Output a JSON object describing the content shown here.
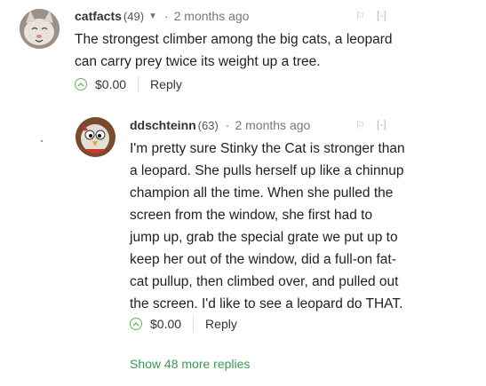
{
  "comments": [
    {
      "username": "catfacts",
      "score": "(49)",
      "time": "2 months ago",
      "text_lines": [
        "The strongest climber among the big cats, a leopard",
        "can carry prey twice its weight up a tree."
      ],
      "tip": "$0.00",
      "reply_label": "Reply",
      "avatar_icon": "cat-face-avatar"
    },
    {
      "username": "ddschteinn",
      "score": "(63)",
      "time": "2 months ago",
      "text_lines": [
        "I'm pretty sure Stinky the Cat is stronger than",
        "a leopard. She pulls herself up like a chinnup",
        "champion all the time. When she pulled the",
        "screen from the window, she first had to",
        "jump up, grab the special grate we put up to",
        "keep her out of the window, did a full-on fat-",
        "cat pullup, then climbed over, and pulled out",
        "the screen. I'd like to see a leopard do THAT."
      ],
      "tip": "$0.00",
      "reply_label": "Reply",
      "avatar_icon": "owl-cartoon-avatar"
    }
  ],
  "more_replies_label": "Show 48 more replies",
  "collapse_label": "[-]",
  "colors": {
    "accent_green": "#3c9a53",
    "upvote_green": "#5cb85c"
  }
}
